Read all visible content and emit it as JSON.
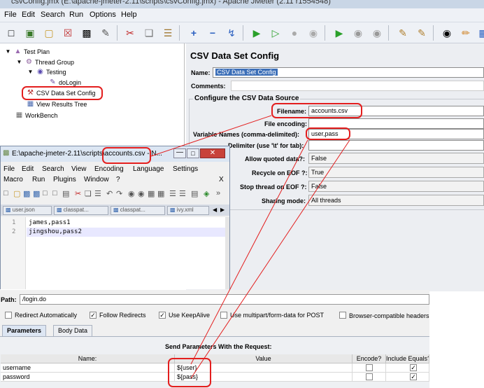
{
  "window": {
    "title": "csvConfig.jmx (E:\\apache-jmeter-2.11\\scripts\\csvConfig.jmx) - Apache JMeter (2.11 r1554548)"
  },
  "menu": [
    "File",
    "Edit",
    "Search",
    "Run",
    "Options",
    "Help"
  ],
  "tree": {
    "test_plan": "Test Plan",
    "thread_group": "Thread Group",
    "testing": "Testing",
    "dologin": "doLogin",
    "csv_config": "CSV Data Set Config",
    "view_results": "View Results Tree",
    "workbench": "WorkBench"
  },
  "csv_panel": {
    "title": "CSV Data Set Config",
    "name_label": "Name:",
    "name_value": "CSV Data Set Config",
    "comments_label": "Comments:",
    "group_title": "Configure the CSV Data Source",
    "filename_label": "Filename:",
    "filename_value": "accounts.csv",
    "encoding_label": "File encoding:",
    "encoding_value": "",
    "varnames_label": "Variable Names (comma-delimited):",
    "varnames_value": "user,pass",
    "delimiter_label": "Delimiter (use '\\t' for tab):",
    "delimiter_value": "",
    "quoted_label": "Allow quoted data?:",
    "quoted_value": "False",
    "recycle_label": "Recycle on EOF ?:",
    "recycle_value": "True",
    "stop_label": "Stop thread on EOF ?:",
    "stop_value": "False",
    "sharing_label": "Sharing mode:",
    "sharing_value": "All threads"
  },
  "notepad": {
    "title_prefix": "E:\\apache-jmeter-2.11\\scripts\\",
    "title_file": "accounts.csv",
    "title_suffix": " - N...",
    "menu1": [
      "File",
      "Edit",
      "Search",
      "View",
      "Encoding",
      "Language",
      "Settings"
    ],
    "menu2": [
      "Macro",
      "Run",
      "Plugins",
      "Window",
      "?"
    ],
    "close_x": "X",
    "tabs": [
      "user.json",
      "classpat...",
      "classpat...",
      "ivy.xml"
    ],
    "lines": [
      {
        "num": "1",
        "text": "james,pass1"
      },
      {
        "num": "2",
        "text": "jingshou,pass2"
      }
    ]
  },
  "http": {
    "path_label": "Path:",
    "path_value": "/login.do",
    "options": [
      {
        "label": "Redirect Automatically",
        "checked": false
      },
      {
        "label": "Follow Redirects",
        "checked": true
      },
      {
        "label": "Use KeepAlive",
        "checked": true
      },
      {
        "label": "Use multipart/form-data for POST",
        "checked": false
      },
      {
        "label": "Browser-compatible headers",
        "checked": false
      }
    ],
    "tabs": [
      "Parameters",
      "Body Data"
    ],
    "section_title": "Send Parameters With the Request:",
    "columns": [
      "Name:",
      "Value",
      "Encode?",
      "Include Equals?"
    ],
    "rows": [
      {
        "name": "username",
        "value": "${user}",
        "encode": false,
        "include": true
      },
      {
        "name": "password",
        "value": "${pass}",
        "encode": false,
        "include": true
      }
    ]
  }
}
